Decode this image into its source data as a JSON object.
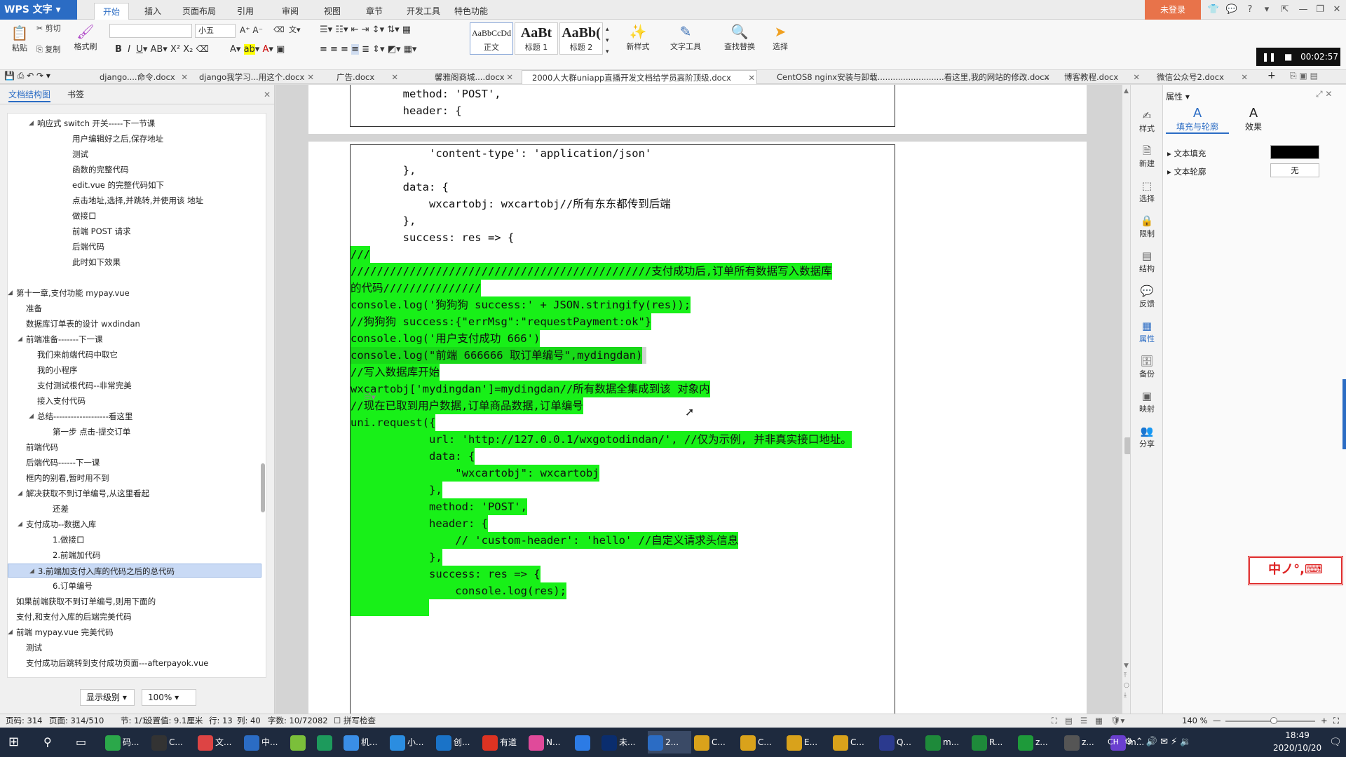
{
  "app": {
    "logo": "WPS 文字",
    "login": "未登录"
  },
  "menu_tabs": [
    "开始",
    "插入",
    "页面布局",
    "引用",
    "审阅",
    "视图",
    "章节",
    "开发工具",
    "特色功能"
  ],
  "ribbon": {
    "paste": "粘贴",
    "cut": "剪切",
    "copy": "复制",
    "format_painter": "格式刷",
    "font_name": "",
    "font_size": "小五",
    "styles": [
      {
        "preview": "AaBbCcDd",
        "label": "正文"
      },
      {
        "preview": "AaBt",
        "label": "标题 1"
      },
      {
        "preview": "AaBb(",
        "label": "标题 2"
      }
    ],
    "new_style": "新样式",
    "text_tool": "文字工具",
    "find_replace": "查找替换",
    "select": "选择"
  },
  "recording": {
    "time": "00:02:57"
  },
  "doc_tabs": [
    {
      "label": "django....命令.docx"
    },
    {
      "label": "django我学习...用这个.docx"
    },
    {
      "label": "广告.docx"
    },
    {
      "label": "馨雅阁商城....docx"
    },
    {
      "label": "2000人大群uniapp直播开发文档给学员高阶顶级.docx",
      "active": true
    },
    {
      "label": "CentOS8 nginx安装与卸载..........................看这里,我的网站的修改.docx"
    },
    {
      "label": "博客教程.docx"
    },
    {
      "label": "微信公众号2.docx"
    }
  ],
  "nav": {
    "tabs": [
      "文档结构图",
      "书签"
    ],
    "items": [
      {
        "label": "响应式 switch 开关-----下一节课",
        "level": 2,
        "tw": "▲"
      },
      {
        "label": "用户编辑好之后,保存地址",
        "level": 4
      },
      {
        "label": "测试",
        "level": 4
      },
      {
        "label": "函数的完整代码",
        "level": 4
      },
      {
        "label": "edit.vue 的完整代码如下",
        "level": 4
      },
      {
        "label": "点击地址,选择,并跳转,并使用该 地址",
        "level": 4
      },
      {
        "label": "做接口",
        "level": 4
      },
      {
        "label": "前端 POST 请求",
        "level": 4
      },
      {
        "label": "后端代码",
        "level": 4
      },
      {
        "label": "此时如下效果",
        "level": 4
      },
      {
        "label": "",
        "level": 0
      },
      {
        "label": "第十一章,支付功能 mypay.vue",
        "level": 0,
        "tw": "▲"
      },
      {
        "label": "准备",
        "level": 1
      },
      {
        "label": "数据库订单表的设计 wxdindan",
        "level": 1
      },
      {
        "label": "前端准备-------下一课",
        "level": 1,
        "tw": "▲"
      },
      {
        "label": "我们来前端代码中取它",
        "level": 2
      },
      {
        "label": "我的小程序",
        "level": 2
      },
      {
        "label": "支付测试根代码--非常完美",
        "level": 2
      },
      {
        "label": "接入支付代码",
        "level": 2
      },
      {
        "label": "总结-------------------看这里",
        "level": 2,
        "tw": "▲"
      },
      {
        "label": "第一步 点击-提交订单",
        "level": 3
      },
      {
        "label": "前端代码",
        "level": 1
      },
      {
        "label": "后端代码------下一课",
        "level": 1
      },
      {
        "label": "框内的别看,暂时用不到",
        "level": 1
      },
      {
        "label": "解决获取不到订单编号,从这里看起",
        "level": 1,
        "tw": "▲"
      },
      {
        "label": "还差",
        "level": 3
      },
      {
        "label": "支付成功--数据入库",
        "level": 1,
        "tw": "▲"
      },
      {
        "label": "1.做接口",
        "level": 3
      },
      {
        "label": "2.前端加代码",
        "level": 3
      },
      {
        "label": "3.前端加支付入库的代码之后的总代码",
        "level": 2,
        "tw": "▲",
        "selected": true
      },
      {
        "label": "6.订单编号",
        "level": 3
      },
      {
        "label": "如果前端获取不到订单编号,则用下面的",
        "level": 0
      },
      {
        "label": "支付,和支付入库的后端完美代码",
        "level": 0
      },
      {
        "label": "前端 mypay.vue 完美代码",
        "level": 0,
        "tw": "▲"
      },
      {
        "label": "测试",
        "level": 1
      },
      {
        "label": "支付成功后跳转到支付成功页面---afterpayok.vue",
        "level": 1
      }
    ],
    "show_level": "显示级别",
    "zoom": "100%"
  },
  "code_page1": [
    {
      "text": "        method: 'POST',",
      "hl": false
    },
    {
      "text": "        header: {",
      "hl": false
    }
  ],
  "code_page2": [
    {
      "text": "            'content-type': 'application/json'",
      "hl": false
    },
    {
      "text": "        },",
      "hl": false
    },
    {
      "text": "        data: {",
      "hl": false
    },
    {
      "text": "            wxcartobj: wxcartobj//所有东东都传到后端",
      "hl": false
    },
    {
      "text": "        },",
      "hl": false
    },
    {
      "text": "        success: res => {",
      "hl": false
    },
    {
      "text": "///",
      "hl": true
    },
    {
      "text": "//////////////////////////////////////////////支付成功后,订单所有数据写入数据库",
      "hl": true
    },
    {
      "text": "的代码///////////////",
      "hl": true
    },
    {
      "text": "console.log('狗狗狗 success:' + JSON.stringify(res));",
      "hl": true
    },
    {
      "text": "//狗狗狗 success:{\"errMsg\":\"requestPayment:ok\"}",
      "hl": true
    },
    {
      "text": "console.log('用户支付成功 666')",
      "hl": true
    },
    {
      "text": "console.log(\"前端 666666 取订单编号\",mydingdan)",
      "hl": true,
      "sel": true
    },
    {
      "text": "//写入数据库开始",
      "hl": true
    },
    {
      "text": "wxcartobj['mydingdan']=mydingdan//所有数据全集成到该 对象内",
      "hl": true
    },
    {
      "text": "//现在已取到用户数据,订单商品数据,订单编号",
      "hl": true
    },
    {
      "text": "uni.request({",
      "hl": true
    },
    {
      "text": "            url: 'http://127.0.0.1/wxgotodindan/', //仅为示例, 并非真实接口地址。",
      "hl": true
    },
    {
      "text": "            data: {",
      "hl": true
    },
    {
      "text": "                \"wxcartobj\": wxcartobj",
      "hl": true
    },
    {
      "text": "            },",
      "hl": true
    },
    {
      "text": "            method: 'POST',",
      "hl": true
    },
    {
      "text": "            header: {",
      "hl": true
    },
    {
      "text": "                // 'custom-header': 'hello' //自定义请求头信息",
      "hl": true
    },
    {
      "text": "            },",
      "hl": true
    },
    {
      "text": "            success: res => {",
      "hl": true
    },
    {
      "text": "                console.log(res);",
      "hl": true
    },
    {
      "text": "            ",
      "hl": true
    }
  ],
  "side_strip": [
    "样式",
    "新建",
    "选择",
    "限制",
    "结构",
    "反馈",
    "属性",
    "备份",
    "映射",
    "分享"
  ],
  "properties": {
    "title": "属性",
    "tabs": [
      "填充与轮廓",
      "效果"
    ],
    "fill_label": "文本填充",
    "outline_label": "文本轮廓",
    "outline_value": "无",
    "fill_color": "#000000"
  },
  "ime": "中ノ°,⌨",
  "status": {
    "page_code": "页码: 314",
    "pages": "页面: 314/510",
    "section": "节: 1/1",
    "position": "设置值: 9.1厘米",
    "row": "行: 13",
    "col": "列: 40",
    "words": "字数: 10/72082",
    "spell": "拼写检查",
    "zoom": "140 %"
  },
  "taskbar": {
    "items": [
      "码...",
      "C...",
      "文...",
      "中...",
      "",
      "",
      "机...",
      "小...",
      "创...",
      "有道",
      "N...",
      "",
      "未...",
      "2...",
      "C...",
      "C...",
      "E...",
      "C...",
      "Q...",
      "m...",
      "R...",
      "z...",
      "z...",
      "m..."
    ],
    "time": "18:49",
    "date": "2020/10/20",
    "lang": "CH"
  },
  "colors": {
    "highlight": "#18f018",
    "accent": "#2b6cc4",
    "login": "#e8734a"
  }
}
